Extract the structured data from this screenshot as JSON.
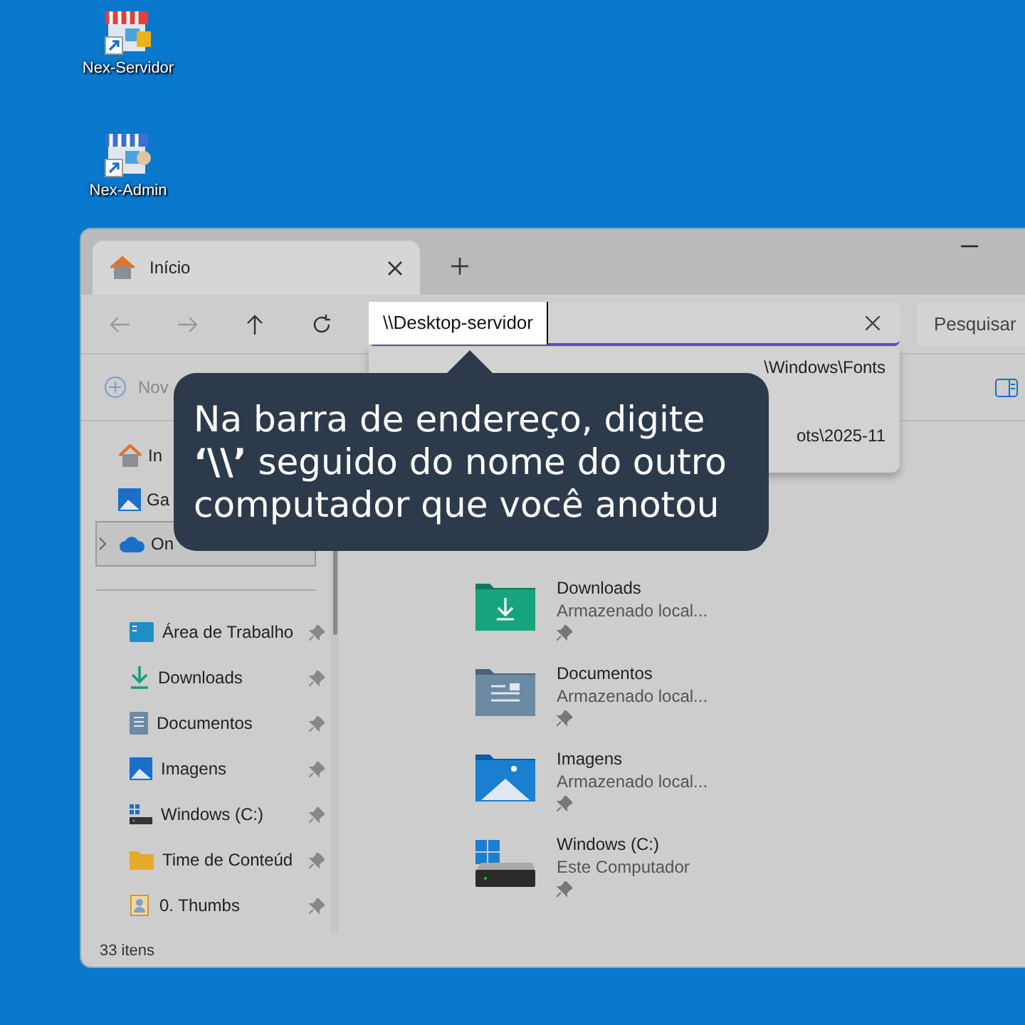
{
  "desktop_icons": [
    {
      "label": "Nex-Servidor",
      "kind": "server"
    },
    {
      "label": "Nex-Admin",
      "kind": "admin"
    }
  ],
  "window": {
    "tab": {
      "title": "Início",
      "selected": true
    },
    "address": "\\\\Desktop-servidor",
    "search_placeholder": "Pesquisar",
    "suggestions": [
      "\\Windows\\Fonts",
      "ots\\2025-11"
    ],
    "toolbar": {
      "new_label": "Nov"
    },
    "sidebar": {
      "top_items": [
        {
          "label": "In",
          "kind": "home",
          "selected": false
        },
        {
          "label": "Ga",
          "kind": "gallery",
          "selected": false
        },
        {
          "label": "On",
          "kind": "cloud",
          "selected": true
        }
      ],
      "pinned_items": [
        {
          "label": "Área de Trabalho",
          "kind": "desktop"
        },
        {
          "label": "Downloads",
          "kind": "download"
        },
        {
          "label": "Documentos",
          "kind": "doc"
        },
        {
          "label": "Imagens",
          "kind": "image"
        },
        {
          "label": "Windows (C:)",
          "kind": "drive"
        },
        {
          "label": "Time de Conteúd",
          "kind": "folder"
        },
        {
          "label": "0. Thumbs",
          "kind": "user"
        }
      ]
    },
    "items": [
      {
        "name": "Downloads",
        "detail": "Armazenado local...",
        "kind": "download"
      },
      {
        "name": "Documentos",
        "detail": "Armazenado local...",
        "kind": "doc"
      },
      {
        "name": "Imagens",
        "detail": "Armazenado local...",
        "kind": "image"
      },
      {
        "name": "Windows (C:)",
        "detail": "Este Computador",
        "kind": "drive"
      }
    ],
    "status_bar": "33 itens"
  },
  "tooltip": "Na barra de endereço, digite **‘\\\\’** seguido do nome do outro computador que você anotou"
}
